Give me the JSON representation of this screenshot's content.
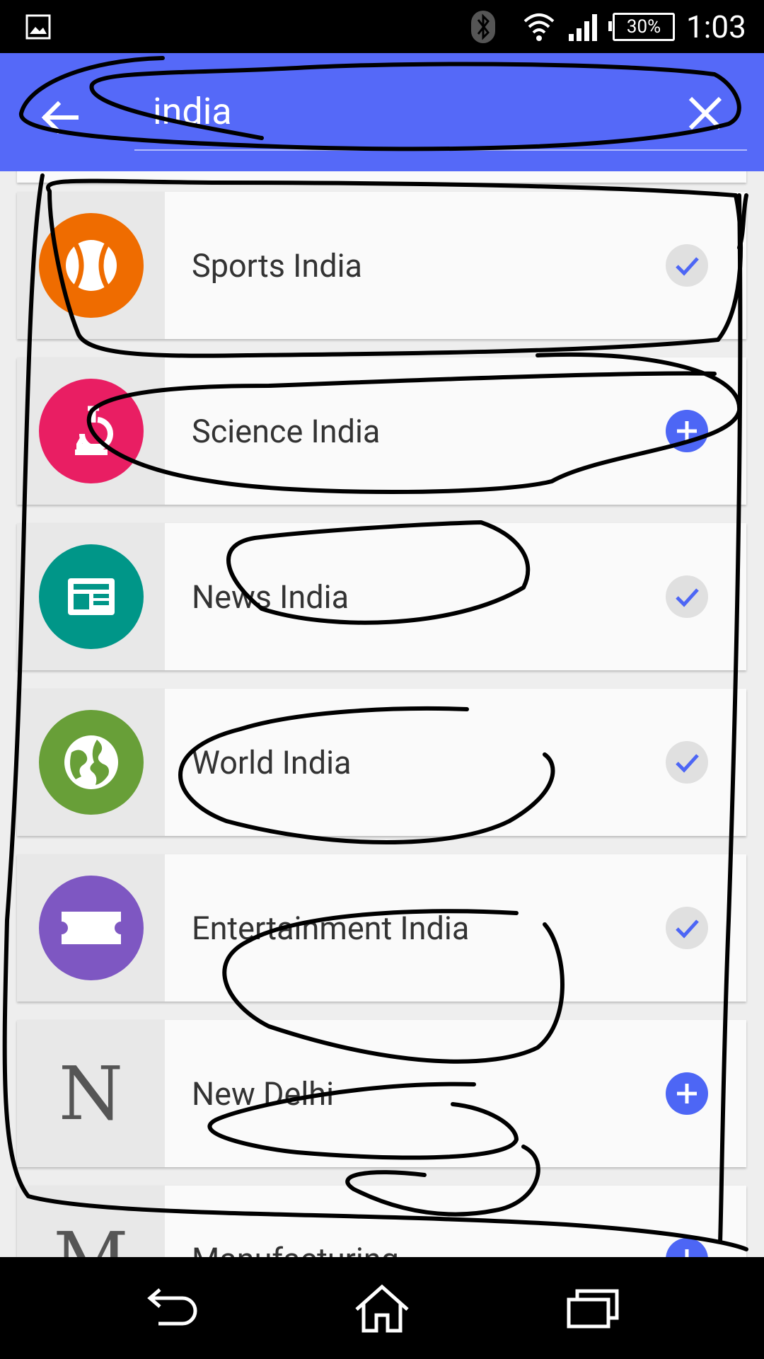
{
  "status_bar": {
    "icons": [
      "gallery-icon",
      "bluetooth-icon",
      "wifi-icon",
      "signal-icon"
    ],
    "battery": "30%",
    "time": "1:03"
  },
  "search": {
    "query": "india",
    "back_icon": "arrow-left-icon",
    "clear_icon": "close-icon"
  },
  "results": [
    {
      "title": "Sports India",
      "icon": "baseball-icon",
      "color": "#ef6c00",
      "state": "followed"
    },
    {
      "title": "Science India",
      "icon": "microscope-icon",
      "color": "#e91e63",
      "state": "add"
    },
    {
      "title": "News India",
      "icon": "newspaper-icon",
      "color": "#009688",
      "state": "followed"
    },
    {
      "title": "World India",
      "icon": "globe-icon",
      "color": "#689f38",
      "state": "followed"
    },
    {
      "title": "Entertainment India",
      "icon": "ticket-icon",
      "color": "#7e57c2",
      "state": "followed"
    },
    {
      "title": "New Delhi",
      "letter": "N",
      "state": "add"
    },
    {
      "title": "Manufacturing",
      "letter": "M",
      "state": "add"
    }
  ],
  "colors": {
    "app_bar": "#5569f8",
    "accent": "#4d66f5",
    "followed_check": "#4d66f5"
  },
  "nav_bar": {
    "icons": [
      "nav-back-icon",
      "nav-home-icon",
      "nav-recent-apps-icon"
    ]
  }
}
